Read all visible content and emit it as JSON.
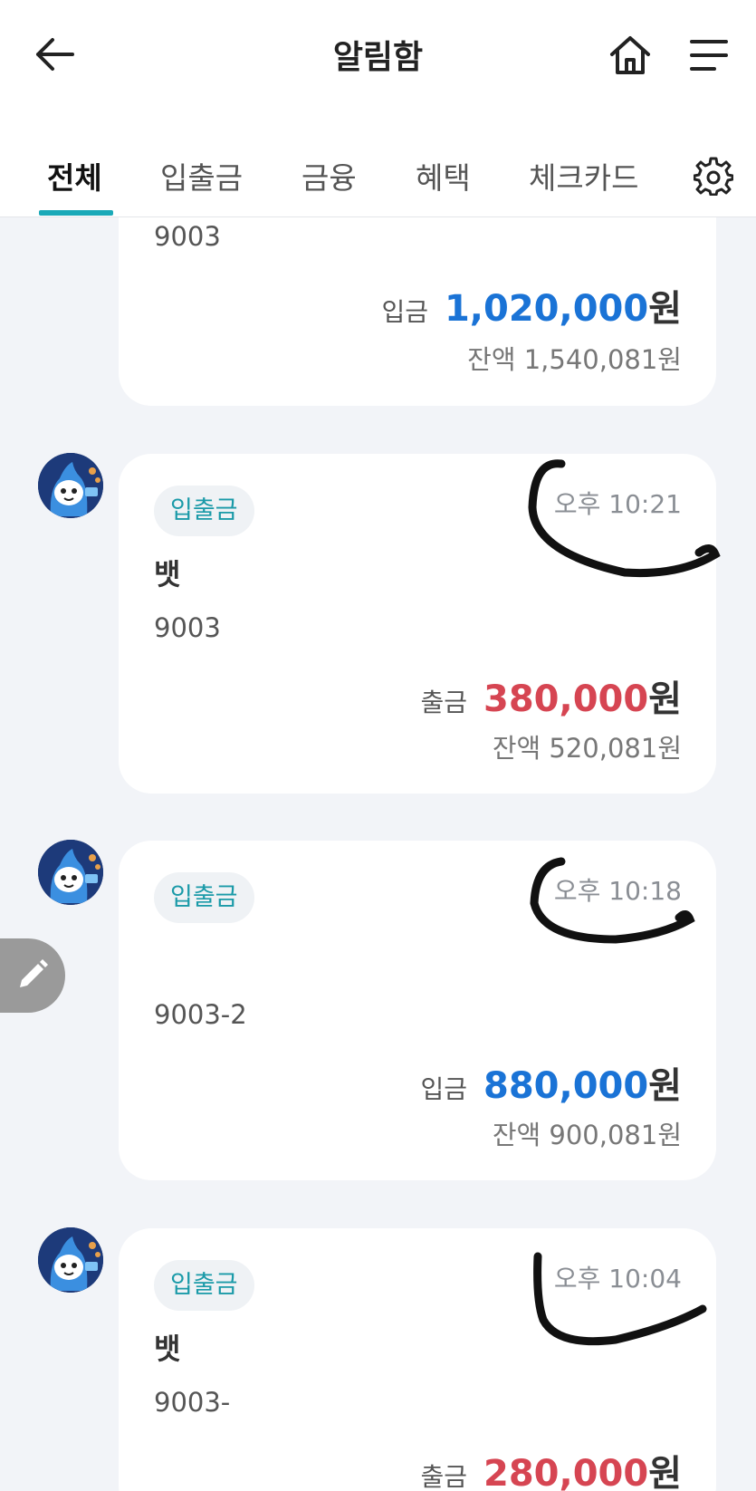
{
  "header": {
    "title": "알림함"
  },
  "tabs": [
    {
      "label": "전체",
      "active": true
    },
    {
      "label": "입출금",
      "active": false
    },
    {
      "label": "금융",
      "active": false
    },
    {
      "label": "혜택",
      "active": false
    },
    {
      "label": "체크카드",
      "active": false
    }
  ],
  "colors": {
    "accent": "#1aa9b8",
    "deposit": "#1a73d6",
    "withdrawal": "#d64552",
    "chip_text": "#1a9aa8"
  },
  "cards": [
    {
      "account": "9003",
      "type_label": "입금",
      "amount": "1,020,000",
      "unit": "원",
      "balance": "잔액 1,540,081원"
    },
    {
      "chip": "입출금",
      "time": "오후 10:21",
      "name": "뱃",
      "account": "9003",
      "type_label": "출금",
      "amount": "380,000",
      "unit": "원",
      "balance": "잔액 520,081원"
    },
    {
      "chip": "입출금",
      "time": "오후 10:18",
      "account": "9003-2",
      "type_label": "입금",
      "amount": "880,000",
      "unit": "원",
      "balance": "잔액 900,081원"
    },
    {
      "chip": "입출금",
      "time": "오후 10:04",
      "name": "뱃",
      "account": "9003-",
      "type_label": "출금",
      "amount": "280,000",
      "unit": "원"
    }
  ]
}
